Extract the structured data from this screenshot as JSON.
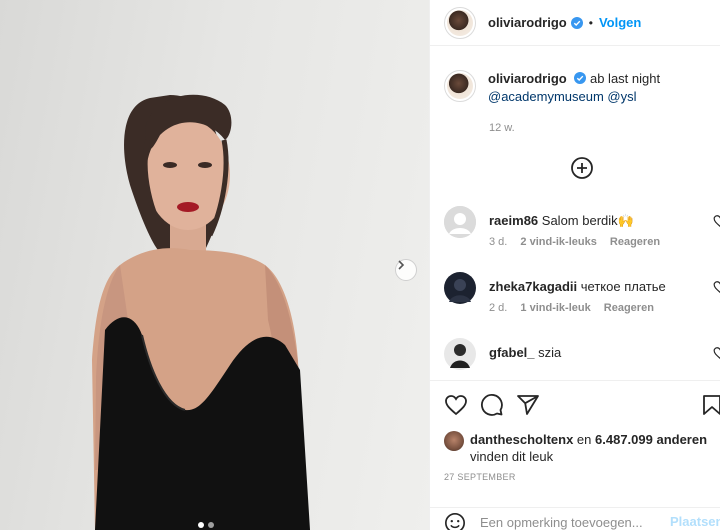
{
  "post": {
    "author": "oliviarodrigo",
    "follow_label": "Volgen",
    "bullet": "•",
    "caption_text": "ab last night",
    "caption_mentions": "@academymuseum @ysl",
    "age": "12 w.",
    "add_comments_icon": "plus-circle-icon"
  },
  "comments": [
    {
      "user": "raeim86",
      "text": "Salom berdik🙌",
      "age": "3 d.",
      "likes": "2 vind-ik-leuks",
      "reply": "Reageren"
    },
    {
      "user": "zheka7kagadii",
      "text": "четкое платье",
      "age": "2 d.",
      "likes": "1 vind-ik-leuk",
      "reply": "Reageren"
    },
    {
      "user": "gfabel_",
      "text": "szia",
      "age": "",
      "likes": "",
      "reply": ""
    }
  ],
  "likes": {
    "user": "danthescholtenx",
    "connector": "en",
    "count_text": "6.487.099 anderen",
    "suffix": "vinden dit leuk"
  },
  "date": "27 SEPTEMBER",
  "comment_box": {
    "placeholder": "Een opmerking toevoegen...",
    "post_label": "Plaatsen"
  },
  "colors": {
    "accent": "#0095f6",
    "verified": "#3897f0",
    "dress": "#111111"
  }
}
